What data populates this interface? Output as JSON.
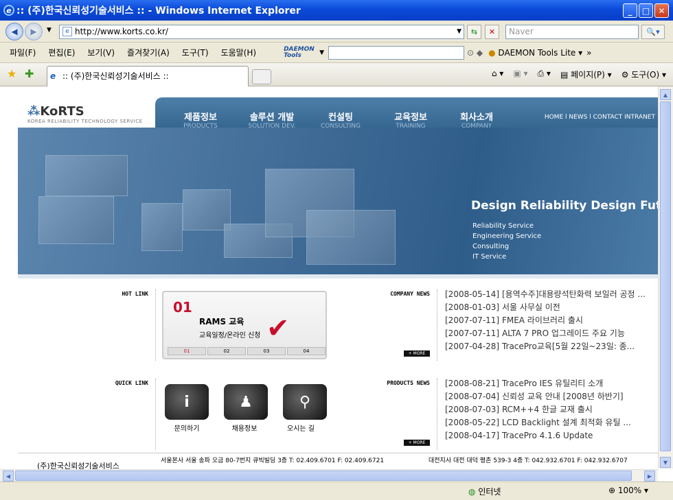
{
  "window": {
    "title": ":: (주)한국신뢰성기술서비스 :: - Windows Internet Explorer"
  },
  "address": {
    "url": "http://www.korts.co.kr/",
    "search_placeholder": "Naver"
  },
  "menu": [
    "파일(F)",
    "편집(E)",
    "보기(V)",
    "즐겨찾기(A)",
    "도구(T)",
    "도움말(H)"
  ],
  "daemon": {
    "logo": "DAEMON Tools",
    "label": "DAEMON Tools Lite"
  },
  "tab": {
    "title": ":: (주)한국신뢰성기술서비스 ::"
  },
  "toolbar": {
    "page": "페이지(P)",
    "tools": "도구(O)"
  },
  "site": {
    "logo": "KoRTS",
    "logo_sub": "KOREA RELIABILITY TECHNOLOGY SERVICE",
    "nav": [
      {
        "ko": "제품정보",
        "en": "PRODUCTS"
      },
      {
        "ko": "솔루션 개발",
        "en": "SOLUTION DEV."
      },
      {
        "ko": "컨설팅",
        "en": "CONSULTING"
      },
      {
        "ko": "교육정보",
        "en": "TRAINING"
      },
      {
        "ko": "회사소개",
        "en": "COMPANY"
      }
    ],
    "topmenu": "HOME l NEWS l CONTACT   INTRANET",
    "hero_title": "Design Reliability Design Future",
    "hero_list": [
      "Reliability Service",
      "Engineering Service",
      "Consulting",
      "IT Service"
    ],
    "hotlink": "HOT LINK",
    "quicklink": "QUICK LINK",
    "company_news": "COMPANY NEWS",
    "products_news": "PRODUCTS NEWS",
    "banner": {
      "num": "01",
      "title": "RAMS 교육",
      "sub": "교육일정/온라인 신청",
      "tabs": [
        "01",
        "02",
        "03",
        "04"
      ]
    },
    "company_news_items": [
      {
        "date": "[2008-05-14]",
        "text": "[용역수주]대용량석탄화력 보일러 공정 ..."
      },
      {
        "date": "[2008-01-03]",
        "text": "서울 사무실 이전"
      },
      {
        "date": "[2007-07-11]",
        "text": "FMEA 라이브러리 출시"
      },
      {
        "date": "[2007-07-11]",
        "text": "ALTA 7 PRO 업그레이드 주요 기능"
      },
      {
        "date": "[2007-04-28]",
        "text": "TracePro교육[5월 22일~23일: 종..."
      }
    ],
    "products_news_items": [
      {
        "date": "[2008-08-21]",
        "text": "TracePro IES 유틸리티 소개"
      },
      {
        "date": "[2008-07-04]",
        "text": "신뢰성 교육 안내 [2008년 하반기]"
      },
      {
        "date": "[2008-07-03]",
        "text": "RCM++4 한글 교재 출시"
      },
      {
        "date": "[2008-05-22]",
        "text": "LCD Backlight 설계 최적화 유틸 ..."
      },
      {
        "date": "[2008-04-17]",
        "text": "TracePro 4.1.6 Update"
      }
    ],
    "more": "+ MORE",
    "quick": [
      "문의하기",
      "채용정보",
      "오시는 길"
    ],
    "footer": {
      "company": "(주)한국신뢰성기술서비스",
      "seoul": "서울본사 서울 송파 오금 80-7번지 큐빅빌딩 3층  T: 02.409.6701 F: 02.409.6721",
      "daejeon": "대전지사 대전 대덕 평촌 539-3 4층 T: 042.932.6701 F: 042.932.6707"
    }
  },
  "status": {
    "zone": "인터넷",
    "zoom": "100%"
  }
}
